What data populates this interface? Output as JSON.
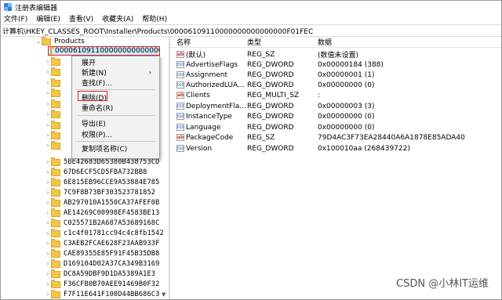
{
  "window": {
    "title": "注册表编辑器"
  },
  "menu": [
    "文件(F)",
    "编辑(E)",
    "查看(V)",
    "收藏夹(A)",
    "帮助(H)"
  ],
  "address": "计算机\\HKEY_CLASSES_ROOT\\Installer\\Products\\00006109110000000000000000F01FEC",
  "tree": {
    "parent": "Products",
    "selected": "00006109110000000000000000F01FEC",
    "keys": [
      "5BE42683D65380B438753CD",
      "67D6ECF5CD5FBA732BB8",
      "6E815EB96CCE9A53884E785",
      "7C9F8B73BF303523781852",
      "AB297010A1550CA37AFEF0B",
      "AE14269C00998EF4583BE13",
      "C025571B2A687A53689168C",
      "c1c4f01781cc94c4c8fb1542",
      "C3AEB2FCAE628F23AAB933F",
      "CAE89355E85F91F45B35DB8",
      "D169104D02A37CA349B3169",
      "DC8A59DBF9D1DA5389A1E3",
      "F36CFB0B70AEE91469B0F32",
      "F7F11E641F100D44BB686C3"
    ]
  },
  "context_menu": {
    "items": [
      "展开",
      "新建(N)",
      "查找(F)...",
      "删除(D)",
      "重命名(R)",
      "导出(E)",
      "权限(P)...",
      "复制项名称(C)"
    ],
    "submenu_arrow": "›"
  },
  "values": {
    "headers": {
      "name": "名称",
      "type": "类型",
      "data": "数据"
    },
    "rows": [
      {
        "icon": "ab",
        "name": "(默认)",
        "type": "REG_SZ",
        "data": "(数值未设置)"
      },
      {
        "icon": "bin",
        "name": "AdvertiseFlags",
        "type": "REG_DWORD",
        "data": "0x00000184 (388)"
      },
      {
        "icon": "bin",
        "name": "Assignment",
        "type": "REG_DWORD",
        "data": "0x00000001 (1)"
      },
      {
        "icon": "bin",
        "name": "AuthorizedLUA...",
        "type": "REG_DWORD",
        "data": "0x00000000 (0)"
      },
      {
        "icon": "ab",
        "name": "Clients",
        "type": "REG_MULTI_SZ",
        "data": ":"
      },
      {
        "icon": "bin",
        "name": "DeploymentFla...",
        "type": "REG_DWORD",
        "data": "0x00000003 (3)"
      },
      {
        "icon": "bin",
        "name": "InstanceType",
        "type": "REG_DWORD",
        "data": "0x00000000 (0)"
      },
      {
        "icon": "bin",
        "name": "Language",
        "type": "REG_DWORD",
        "data": "0x00000000 (0)"
      },
      {
        "icon": "ab",
        "name": "PackageCode",
        "type": "REG_SZ",
        "data": "79D4AC3F73EA28440A6A1878E85ADA40"
      },
      {
        "icon": "bin",
        "name": "Version",
        "type": "REG_DWORD",
        "data": "0x100010aa (268439722)"
      }
    ]
  },
  "watermark": "CSDN @小林IT运维",
  "colors": {
    "highlight_border": "#e02424",
    "selection_bg": "#cce8ff",
    "folder": "#f3c64a"
  }
}
